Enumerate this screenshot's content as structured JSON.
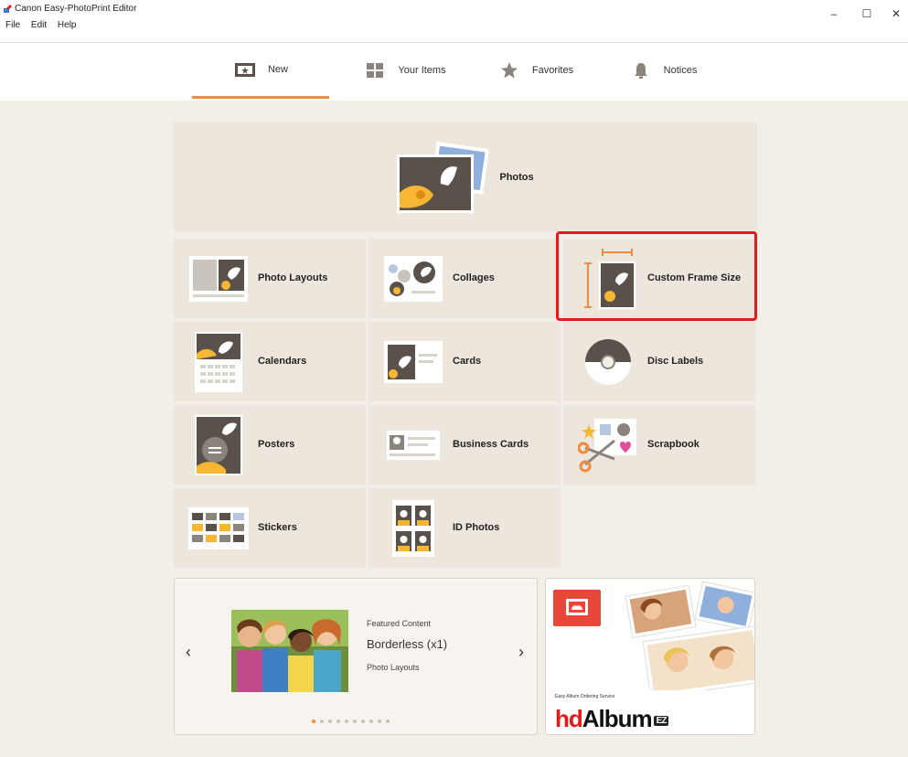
{
  "window": {
    "title": "Canon Easy-PhotoPrint Editor",
    "menu": [
      "File",
      "Edit",
      "Help"
    ],
    "controls": {
      "minimize": "–",
      "maximize": "☐",
      "close": "✕"
    }
  },
  "nav": {
    "tabs": [
      {
        "label": "New",
        "icon": "new-icon",
        "active": true
      },
      {
        "label": "Your Items",
        "icon": "grid-icon",
        "active": false
      },
      {
        "label": "Favorites",
        "icon": "star-icon",
        "active": false
      },
      {
        "label": "Notices",
        "icon": "bell-icon",
        "active": false
      }
    ],
    "accent_color": "#f08a3c"
  },
  "tiles": {
    "photos": "Photos",
    "photo_layouts": "Photo Layouts",
    "collages": "Collages",
    "custom_frame_size": "Custom Frame Size",
    "calendars": "Calendars",
    "cards": "Cards",
    "disc_labels": "Disc Labels",
    "posters": "Posters",
    "business_cards": "Business Cards",
    "scrapbook": "Scrapbook",
    "stickers": "Stickers",
    "id_photos": "ID Photos"
  },
  "featured": {
    "heading": "Featured Content",
    "title": "Borderless (x1)",
    "category": "Photo Layouts",
    "prev": "‹",
    "next": "›",
    "page_count": 10,
    "current_page": 1
  },
  "hd_album": {
    "service": "Easy Album Ordering Service",
    "logo_hd": "hd",
    "logo_album": "Album",
    "logo_ez": "EZ"
  },
  "colors": {
    "highlight": "#e41a1a",
    "tile_bg": "#ece6dc",
    "page_bg": "#f2efe9"
  }
}
